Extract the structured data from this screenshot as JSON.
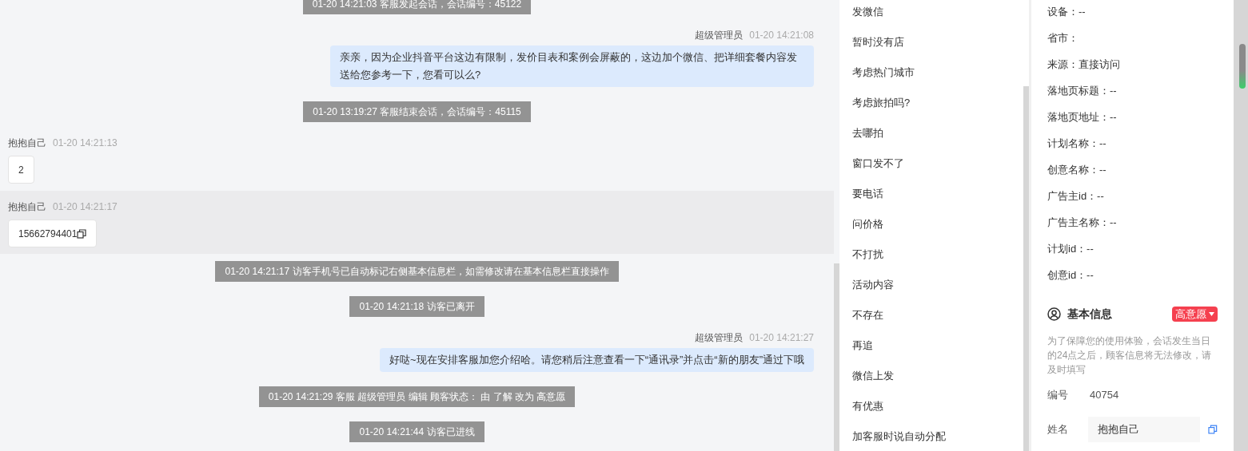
{
  "messages": [
    {
      "kind": "system",
      "highlighted": false,
      "text": "01-20 14:21:03 客服发起会话，会话编号：45122"
    },
    {
      "kind": "agent",
      "highlighted": false,
      "sender": "超级管理员",
      "time": "01-20 14:21:08",
      "text": "亲亲，因为企业抖音平台这边有限制，发价目表和案例会屏蔽的，这边加个微信、把详细套餐内容发送给您参考一下，您看可以么?"
    },
    {
      "kind": "system",
      "highlighted": false,
      "text": "01-20 13:19:27 客服结束会话，会话编号：45115"
    },
    {
      "kind": "customer",
      "highlighted": false,
      "sender": "抱抱自己",
      "time": "01-20 14:21:13",
      "text": "2",
      "copyable": false
    },
    {
      "kind": "customer",
      "highlighted": true,
      "sender": "抱抱自己",
      "time": "01-20 14:21:17",
      "text": "15662794401",
      "copyable": true
    },
    {
      "kind": "system",
      "highlighted": false,
      "text": "01-20 14:21:17 访客手机号已自动标记右侧基本信息栏，如需修改请在基本信息栏直接操作"
    },
    {
      "kind": "system",
      "highlighted": false,
      "text": "01-20 14:21:18 访客已离开"
    },
    {
      "kind": "agent",
      "highlighted": false,
      "sender": "超级管理员",
      "time": "01-20 14:21:27",
      "text": "好哒~现在安排客服加您介绍哈。请您稍后注意查看一下“通讯录”并点击“新的朋友”通过下哦"
    },
    {
      "kind": "system",
      "highlighted": false,
      "text": "01-20 14:21:29 客服 超级管理员 编辑 顾客状态： 由 了解 改为 高意愿"
    },
    {
      "kind": "system",
      "highlighted": false,
      "text": "01-20 14:21:44 访客已进线"
    }
  ],
  "quick_replies": [
    "发微信",
    "暂时没有店",
    "考虑热门城市",
    "考虑旅拍吗?",
    "去哪拍",
    "窗口发不了",
    "要电话",
    "问价格",
    "不打扰",
    "活动内容",
    "不存在",
    "再追",
    "微信上发",
    "有优惠",
    "加客服时说自动分配"
  ],
  "visitor_fields": [
    "设备：--",
    "省市：",
    "来源：直接访问",
    "落地页标题：--",
    "落地页地址：--",
    "计划名称：--",
    "创意名称：--",
    "广告主id：--",
    "广告主名称：--",
    "计划id：--",
    "创意id：--"
  ],
  "basic_info": {
    "title": "基本信息",
    "status_tag": {
      "label": "高意愿",
      "color": "#f5404f"
    },
    "notice": "为了保障您的使用体验，会话发生当日的24点之后，顾客信息将无法修改，请及时填写",
    "id_label": "编号",
    "id_value": "40754",
    "name_label": "姓名",
    "name_value": "抱抱自己"
  }
}
